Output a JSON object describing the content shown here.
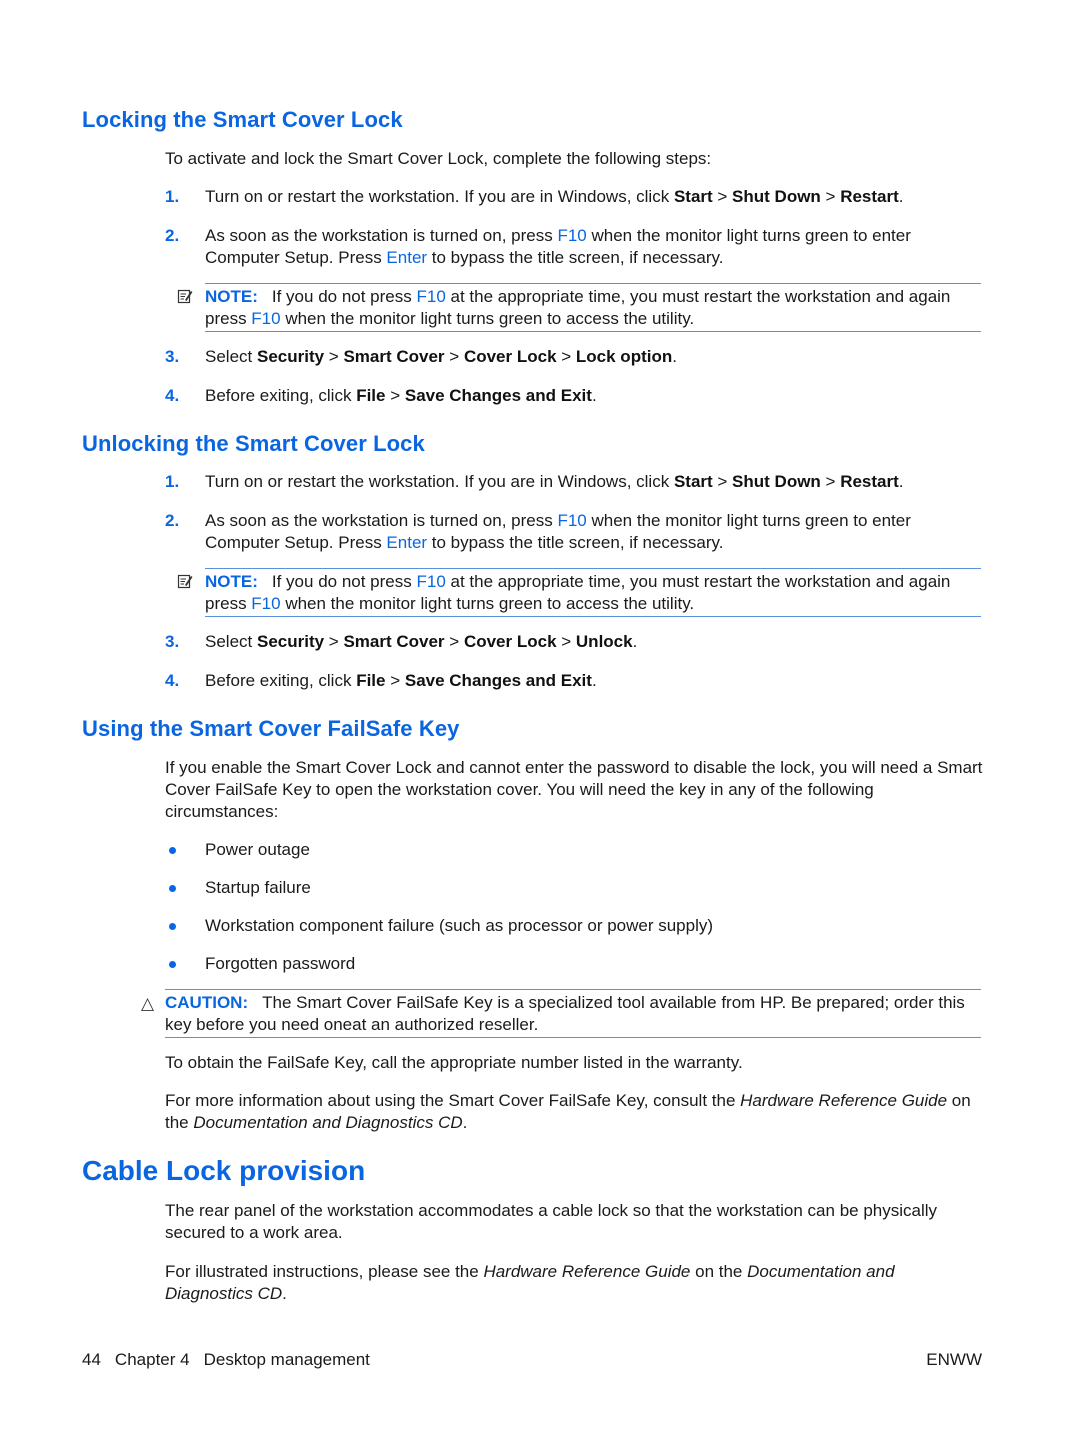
{
  "sections": {
    "locking": {
      "heading": "Locking the Smart Cover Lock",
      "intro": "To activate and lock the Smart Cover Lock, complete the following steps:",
      "step1": {
        "num": "1.",
        "pre": "Turn on or restart the workstation. If you are in Windows, click ",
        "m1": "Start",
        "sep1": " > ",
        "m2": "Shut Down",
        "sep2": " > ",
        "m3": "Restart",
        "post": "."
      },
      "step2": {
        "num": "2.",
        "pre": "As soon as the workstation is turned on, press ",
        "key1": "F10",
        "mid": " when the monitor light turns green to enter Computer Setup. Press ",
        "key2": "Enter",
        "post": " to bypass the title screen, if necessary."
      },
      "note": {
        "label": "NOTE:",
        "pre": "If you do not press ",
        "key1": "F10",
        "mid": " at the appropriate time, you must restart the workstation and again press ",
        "key2": "F10",
        "post": " when the monitor light turns green to access the utility."
      },
      "step3": {
        "num": "3.",
        "pre": "Select ",
        "m1": "Security",
        "sep1": " > ",
        "m2": "Smart Cover",
        "sep2": " > ",
        "m3": "Cover Lock",
        "sep3": " > ",
        "m4": "Lock option",
        "post": "."
      },
      "step4": {
        "num": "4.",
        "pre": "Before exiting, click ",
        "m1": "File",
        "sep1": " > ",
        "m2": "Save Changes and Exit",
        "post": "."
      }
    },
    "unlocking": {
      "heading": "Unlocking the Smart Cover Lock",
      "step1": {
        "num": "1.",
        "pre": "Turn on or restart the workstation. If you are in Windows, click ",
        "m1": "Start",
        "sep1": " > ",
        "m2": "Shut Down",
        "sep2": " > ",
        "m3": "Restart",
        "post": "."
      },
      "step2": {
        "num": "2.",
        "pre": "As soon as the workstation is turned on, press ",
        "key1": "F10",
        "mid": " when the monitor light turns green to enter Computer Setup. Press ",
        "key2": "Enter",
        "post": " to bypass the title screen, if necessary."
      },
      "note": {
        "label": "NOTE:",
        "pre": "If you do not press ",
        "key1": "F10",
        "mid": " at the appropriate time, you must restart the workstation and again press ",
        "key2": "F10",
        "post": " when the monitor light turns green to access the utility."
      },
      "step3": {
        "num": "3.",
        "pre": "Select ",
        "m1": "Security",
        "sep1": " > ",
        "m2": "Smart Cover",
        "sep2": " > ",
        "m3": "Cover Lock",
        "sep3": " > ",
        "m4": "Unlock",
        "post": "."
      },
      "step4": {
        "num": "4.",
        "pre": "Before exiting, click ",
        "m1": "File",
        "sep1": " > ",
        "m2": "Save Changes and Exit",
        "post": "."
      }
    },
    "failsafe": {
      "heading": "Using the Smart Cover FailSafe Key",
      "intro": "If you enable the Smart Cover Lock and cannot enter the password to disable the lock, you will need a Smart Cover FailSafe Key to open the workstation cover. You will need the key in any of the following circumstances:",
      "bullets": [
        "Power outage",
        "Startup failure",
        "Workstation component failure (such as processor or power supply)",
        "Forgotten password"
      ],
      "caution": {
        "label": "CAUTION:",
        "text": "The Smart Cover FailSafe Key is a specialized tool available from HP. Be prepared; order this key before you need oneat an authorized reseller."
      },
      "obtain": "To obtain the FailSafe Key, call the appropriate number listed in the warranty.",
      "more": {
        "pre": "For more information about using the Smart Cover FailSafe Key, consult the ",
        "ital1": "Hardware Reference Guide",
        "mid": " on the ",
        "ital2": "Documentation and Diagnostics CD",
        "post": "."
      }
    },
    "cable": {
      "heading": "Cable Lock provision",
      "p1": "The rear panel of the workstation accommodates a cable lock so that the workstation can be physically secured to a work area.",
      "p2": {
        "pre": "For illustrated instructions, please see the ",
        "ital1": "Hardware Reference Guide",
        "mid": " on the ",
        "ital2": "Documentation and Diagnostics CD",
        "post": "."
      }
    }
  },
  "footer": {
    "page_number": "44",
    "chapter": "Chapter 4",
    "chapter_title": "Desktop management",
    "locale": "ENWW"
  }
}
